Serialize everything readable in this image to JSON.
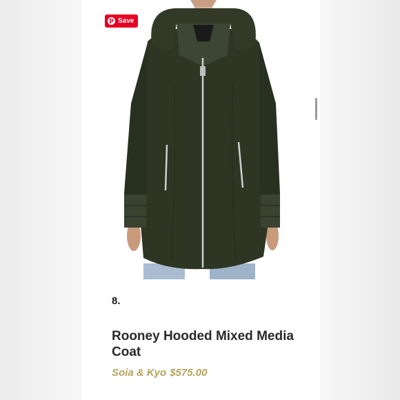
{
  "pin_button": {
    "label": "Save",
    "icon": "pinterest-icon",
    "color": "#e60023"
  },
  "item": {
    "number": "8.",
    "title": "Rooney Hooded Mixed Media Coat",
    "brand": "Soia & Kyo",
    "price": "$575.00"
  },
  "colors": {
    "accent_gold": "#b5a35a",
    "coat": "#2e3523"
  }
}
